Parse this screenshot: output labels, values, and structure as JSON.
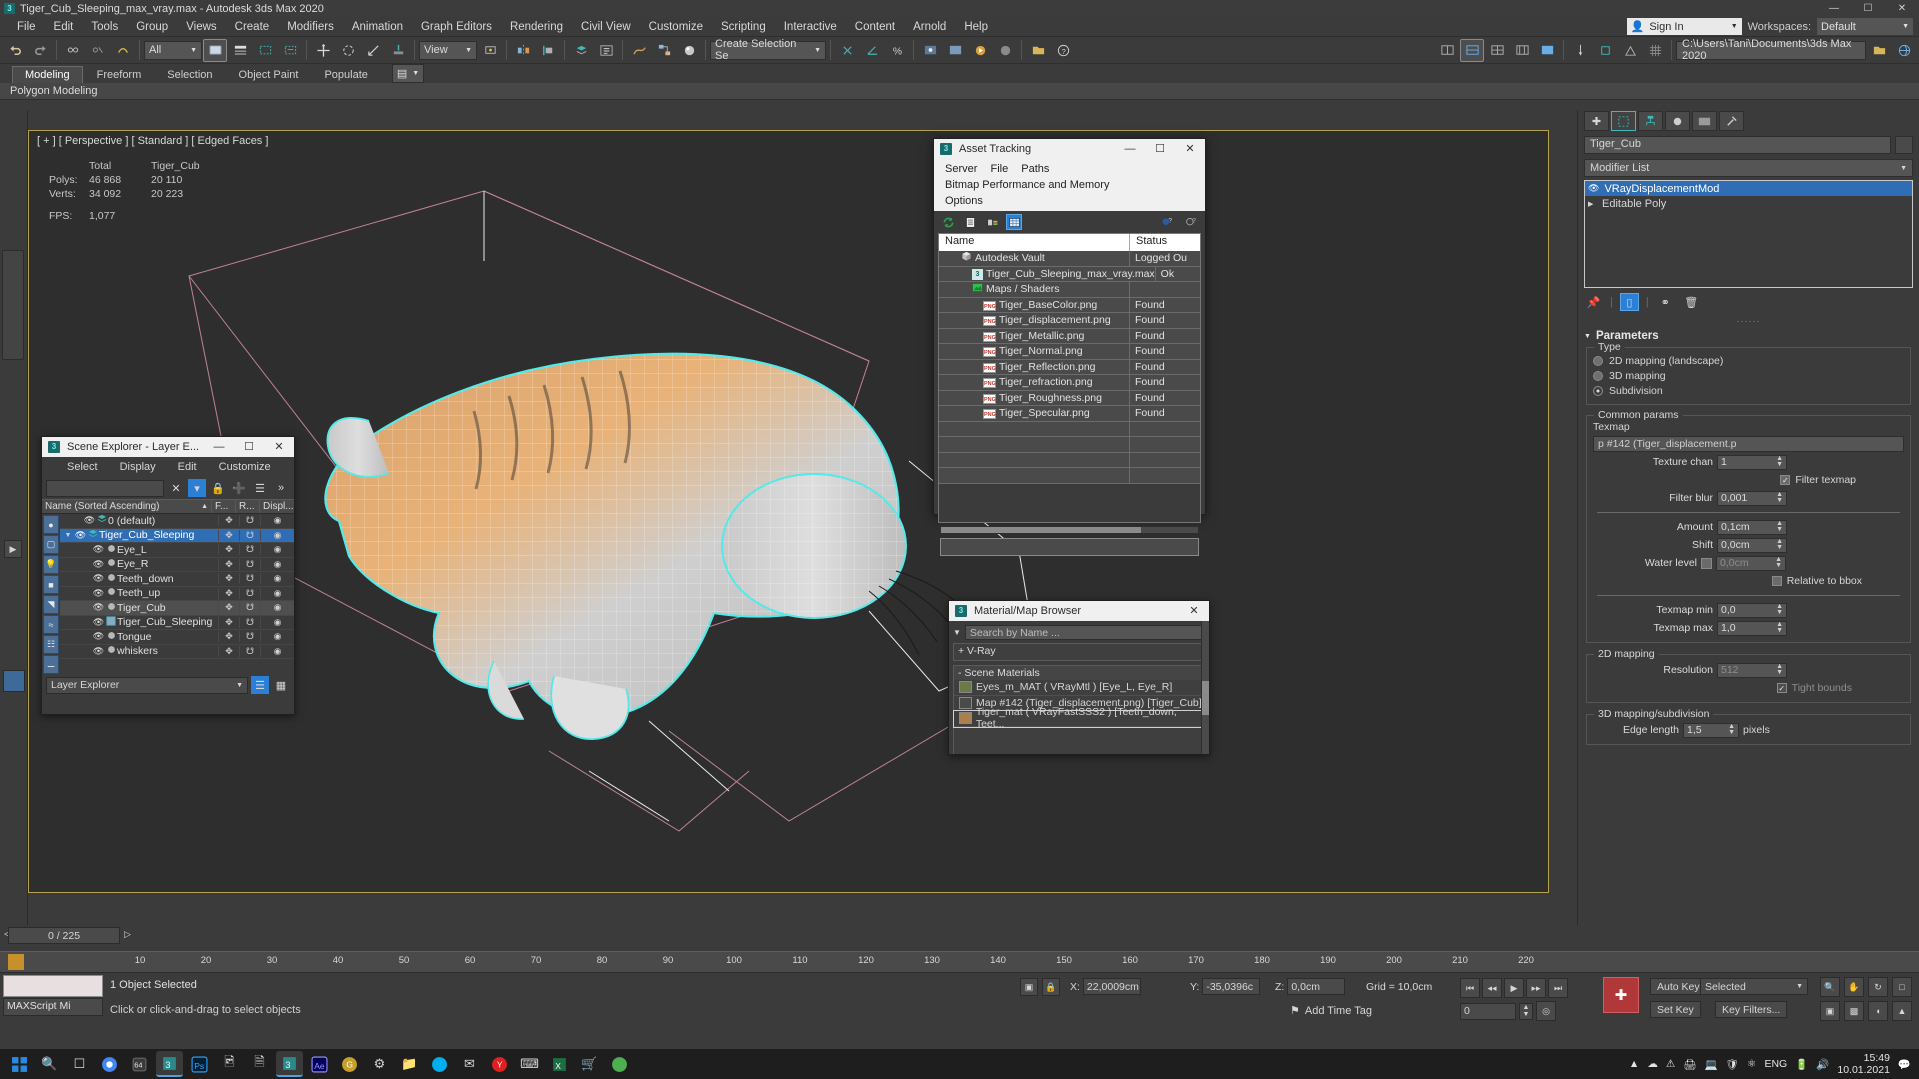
{
  "window": {
    "title": "Tiger_Cub_Sleeping_max_vray.max - Autodesk 3ds Max 2020",
    "icon": "3dsmax-icon",
    "minimize": "—",
    "maximize": "☐",
    "close": "✕"
  },
  "menu": {
    "items": [
      "File",
      "Edit",
      "Tools",
      "Group",
      "Views",
      "Create",
      "Modifiers",
      "Animation",
      "Graph Editors",
      "Rendering",
      "Civil View",
      "Customize",
      "Scripting",
      "Interactive",
      "Content",
      "Arnold",
      "Help"
    ],
    "sign_in": "Sign In",
    "workspaces_label": "Workspaces:",
    "workspace_value": "Default"
  },
  "toolbar": {
    "selection_filter": "All",
    "view_combo": "View",
    "named_selection": "Create Selection Se",
    "project_path": "C:\\Users\\Tani\\Documents\\3ds Max 2020"
  },
  "ribbon": {
    "tabs": [
      "Modeling",
      "Freeform",
      "Selection",
      "Object Paint",
      "Populate"
    ],
    "active_tab": "Modeling",
    "subtitle": "Polygon Modeling"
  },
  "viewport": {
    "label": "[ + ] [ Perspective ] [ Standard ] [ Edged Faces ]",
    "stats": {
      "col_headers": [
        "",
        "Total",
        "Tiger_Cub"
      ],
      "rows": [
        {
          "label": "Polys:",
          "total": "46 868",
          "object": "20 110"
        },
        {
          "label": "Verts:",
          "total": "34 092",
          "object": "20 223"
        }
      ],
      "fps_label": "FPS:",
      "fps_value": "1,077"
    }
  },
  "scene_explorer": {
    "title": "Scene Explorer - Layer E...",
    "menu": [
      "Select",
      "Display",
      "Edit",
      "Customize"
    ],
    "search_value": "",
    "column_headers": [
      "Name (Sorted Ascending)",
      "F...",
      "R...",
      "Displ..."
    ],
    "rows": [
      {
        "name": "0 (default)",
        "indent": 1,
        "expand": "",
        "selected": false,
        "highlight": false,
        "icon": "layer-icon"
      },
      {
        "name": "Tiger_Cub_Sleeping",
        "indent": 0,
        "expand": "▼",
        "selected": true,
        "highlight": false,
        "icon": "layer-icon"
      },
      {
        "name": "Eye_L",
        "indent": 2,
        "expand": "",
        "selected": false,
        "highlight": false,
        "icon": "object-icon"
      },
      {
        "name": "Eye_R",
        "indent": 2,
        "expand": "",
        "selected": false,
        "highlight": false,
        "icon": "object-icon"
      },
      {
        "name": "Teeth_down",
        "indent": 2,
        "expand": "",
        "selected": false,
        "highlight": false,
        "icon": "object-icon"
      },
      {
        "name": "Teeth_up",
        "indent": 2,
        "expand": "",
        "selected": false,
        "highlight": false,
        "icon": "object-icon"
      },
      {
        "name": "Tiger_Cub",
        "indent": 2,
        "expand": "",
        "selected": false,
        "highlight": true,
        "icon": "object-icon"
      },
      {
        "name": "Tiger_Cub_Sleeping",
        "indent": 2,
        "expand": "",
        "selected": false,
        "highlight": false,
        "icon": "modified-object-icon"
      },
      {
        "name": "Tongue",
        "indent": 2,
        "expand": "",
        "selected": false,
        "highlight": false,
        "icon": "object-icon"
      },
      {
        "name": "whiskers",
        "indent": 2,
        "expand": "",
        "selected": false,
        "highlight": false,
        "icon": "object-icon"
      }
    ],
    "footer_combo": "Layer Explorer"
  },
  "asset_tracking": {
    "title": "Asset Tracking",
    "menu": [
      "Server",
      "File",
      "Paths",
      "Bitmap Performance and Memory",
      "Options"
    ],
    "columns": [
      "Name",
      "Status"
    ],
    "rows": [
      {
        "name": "Autodesk Vault",
        "status": "Logged Ou",
        "indent": 1,
        "icon": "vault-icon"
      },
      {
        "name": "Tiger_Cub_Sleeping_max_vray.max",
        "status": "Ok",
        "indent": 2,
        "icon": "max-file-icon"
      },
      {
        "name": "Maps / Shaders",
        "status": "",
        "indent": 2,
        "icon": "maps-icon"
      },
      {
        "name": "Tiger_BaseColor.png",
        "status": "Found",
        "indent": 3,
        "icon": "png-icon"
      },
      {
        "name": "Tiger_displacement.png",
        "status": "Found",
        "indent": 3,
        "icon": "png-icon"
      },
      {
        "name": "Tiger_Metallic.png",
        "status": "Found",
        "indent": 3,
        "icon": "png-icon"
      },
      {
        "name": "Tiger_Normal.png",
        "status": "Found",
        "indent": 3,
        "icon": "png-icon"
      },
      {
        "name": "Tiger_Reflection.png",
        "status": "Found",
        "indent": 3,
        "icon": "png-icon"
      },
      {
        "name": "Tiger_refraction.png",
        "status": "Found",
        "indent": 3,
        "icon": "png-icon"
      },
      {
        "name": "Tiger_Roughness.png",
        "status": "Found",
        "indent": 3,
        "icon": "png-icon"
      },
      {
        "name": "Tiger_Specular.png",
        "status": "Found",
        "indent": 3,
        "icon": "png-icon"
      }
    ]
  },
  "material_browser": {
    "title": "Material/Map Browser",
    "search_placeholder": "Search by Name ...",
    "vray_group": "+ V-Ray",
    "scene_materials_label": "- Scene Materials",
    "items": [
      {
        "name": "Eyes_m_MAT  ( VRayMtl )  [Eye_L, Eye_R]",
        "selected": false
      },
      {
        "name": "Map #142 (Tiger_displacement.png)  [Tiger_Cub]",
        "selected": false
      },
      {
        "name": "Tiger_mat  ( VRayFastSSS2 )  [Teeth_down, Teet...",
        "selected": true
      }
    ]
  },
  "command_panel": {
    "object_name": "Tiger_Cub",
    "modifier_list_label": "Modifier List",
    "stack": [
      {
        "name": "VRayDisplacementMod",
        "selected": true
      },
      {
        "name": "Editable Poly",
        "selected": false
      }
    ],
    "rollout_title": "Parameters",
    "type_group": "Type",
    "type_options": [
      {
        "label": "2D mapping (landscape)",
        "selected": false
      },
      {
        "label": "3D mapping",
        "selected": false
      },
      {
        "label": "Subdivision",
        "selected": true
      }
    ],
    "common_group": "Common params",
    "texmap_label": "Texmap",
    "texmap_value": "p #142 (Tiger_displacement.p",
    "texture_chan_label": "Texture chan",
    "texture_chan_value": "1",
    "filter_texmap_label": "Filter texmap",
    "filter_texmap_checked": true,
    "filter_blur_label": "Filter blur",
    "filter_blur_value": "0,001",
    "amount_label": "Amount",
    "amount_value": "0,1cm",
    "shift_label": "Shift",
    "shift_value": "0,0cm",
    "water_level_label": "Water level",
    "water_level_value": "0,0cm",
    "relative_bbox_label": "Relative to bbox",
    "relative_bbox_checked": false,
    "texmap_min_label": "Texmap min",
    "texmap_min_value": "0,0",
    "texmap_max_label": "Texmap max",
    "texmap_max_value": "1,0",
    "mapping2d_group": "2D mapping",
    "resolution_label": "Resolution",
    "resolution_value": "512",
    "tight_bounds_label": "Tight bounds",
    "subdiv_group": "3D mapping/subdivision",
    "edge_length_label": "Edge length",
    "edge_length_value": "1,5",
    "edge_length_units": "pixels"
  },
  "timeline": {
    "frame_display": "0 / 225",
    "ticks": [
      "10",
      "20",
      "30",
      "40",
      "50",
      "60",
      "70",
      "80",
      "90",
      "100",
      "110",
      "120",
      "130",
      "140",
      "150",
      "160",
      "170",
      "180",
      "190",
      "200",
      "210",
      "220"
    ]
  },
  "statusbar": {
    "maxscript_label": "MAXScript Mi",
    "selection_status": "1 Object Selected",
    "prompt": "Click or click-and-drag to select objects",
    "coord_x_label": "X:",
    "coord_x_value": "22,0009cm",
    "coord_y_label": "Y:",
    "coord_y_value": "-35,0396c",
    "coord_z_label": "Z:",
    "coord_z_value": "0,0cm",
    "grid_label": "Grid = 10,0cm",
    "add_time_tag": "Add Time Tag",
    "auto_key": "Auto Key",
    "set_key": "Set Key",
    "selected_combo": "Selected",
    "key_filters": "Key Filters..."
  },
  "taskbar": {
    "language": "ENG",
    "time": "15:49",
    "date": "10.01.2021"
  }
}
